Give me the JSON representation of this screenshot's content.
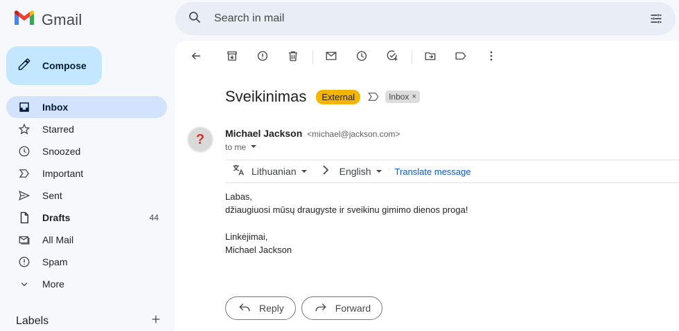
{
  "app": {
    "name": "Gmail"
  },
  "compose": {
    "label": "Compose"
  },
  "sidebar": {
    "items": [
      {
        "label": "Inbox",
        "icon": "inbox-icon",
        "count": "",
        "active": true
      },
      {
        "label": "Starred",
        "icon": "star-icon",
        "count": ""
      },
      {
        "label": "Snoozed",
        "icon": "clock-icon",
        "count": ""
      },
      {
        "label": "Important",
        "icon": "important-icon",
        "count": ""
      },
      {
        "label": "Sent",
        "icon": "send-icon",
        "count": ""
      },
      {
        "label": "Drafts",
        "icon": "draft-icon",
        "count": "44",
        "bold": true
      },
      {
        "label": "All Mail",
        "icon": "all-mail-icon",
        "count": ""
      },
      {
        "label": "Spam",
        "icon": "spam-icon",
        "count": ""
      },
      {
        "label": "More",
        "icon": "chevron-down-icon",
        "count": ""
      }
    ],
    "labels_title": "Labels"
  },
  "search": {
    "placeholder": "Search in mail"
  },
  "message": {
    "subject": "Sveikinimas",
    "badge": "External",
    "label_chip": "Inbox",
    "sender_name": "Michael Jackson",
    "sender_email": "<michael@jackson.com>",
    "to": "to me",
    "translate": {
      "from_lang": "Lithuanian",
      "to_lang": "English",
      "link": "Translate message"
    },
    "body": {
      "line1": "Labas,",
      "line2": "džiaugiuosi mūsų draugyste ir sveikinu gimimo dienos proga!",
      "line3": "Linkėjimai,",
      "line4": "Michael Jackson"
    }
  },
  "actions": {
    "reply": "Reply",
    "forward": "Forward"
  },
  "colors": {
    "compose_bg": "#c2e7ff",
    "active_nav": "#d3e3fd",
    "external_badge": "#f4b400",
    "link": "#0b57d0"
  }
}
